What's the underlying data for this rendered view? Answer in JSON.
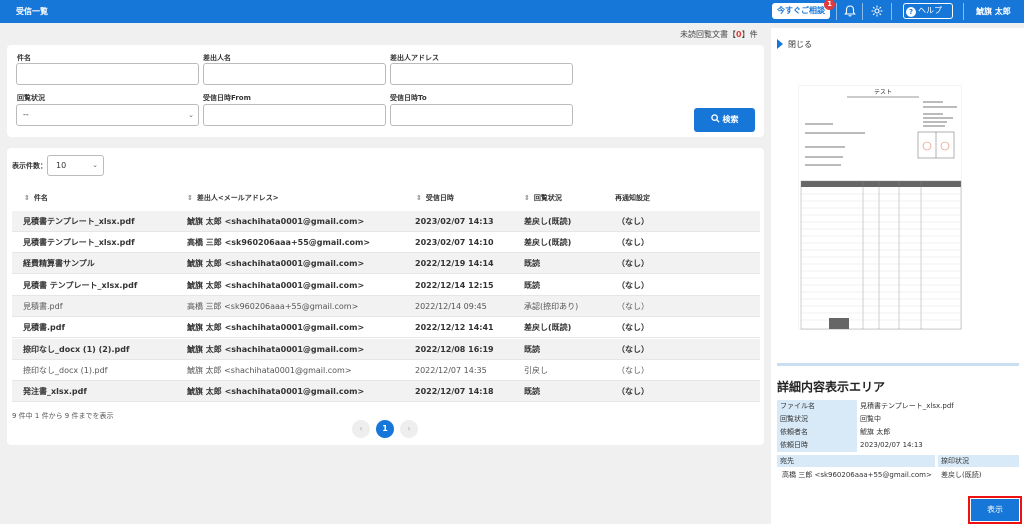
{
  "header": {
    "title": "受信一覧",
    "consult_label": "今すぐご相談",
    "consult_badge": "1",
    "help_label": "ヘルプ",
    "user": "鯱旗 太郎"
  },
  "unread": {
    "prefix": "未読回覧文書【",
    "count": "0",
    "suffix": "】件"
  },
  "search": {
    "subject_label": "件名",
    "sender_name_label": "差出人名",
    "sender_address_label": "差出人アドレス",
    "status_label": "回覧状況",
    "status_value": "--",
    "from_label": "受信日時From",
    "to_label": "受信日時To",
    "search_button": "検索"
  },
  "list": {
    "display_count_label": "表示件数：",
    "display_count_value": "10",
    "columns": [
      "件名",
      "差出人<メールアドレス>",
      "受信日時",
      "回覧状況",
      "再通知設定"
    ],
    "rows": [
      {
        "subject": "見積書テンプレート_xlsx.pdf",
        "sender": "鯱旗 太郎 <shachihata0001@gmail.com>",
        "date": "2023/02/07 14:13",
        "status": "差戻し(既読)",
        "renotify": "（なし）"
      },
      {
        "subject": "見積書テンプレート_xlsx.pdf",
        "sender": "高橋 三郎 <sk960206aaa+55@gmail.com>",
        "date": "2023/02/07 14:10",
        "status": "差戻し(既読)",
        "renotify": "（なし）"
      },
      {
        "subject": "経費精算書サンプル",
        "sender": "鯱旗 太郎 <shachihata0001@gmail.com>",
        "date": "2022/12/19 14:14",
        "status": "既読",
        "renotify": "（なし）"
      },
      {
        "subject": "見積書 テンプレート_xlsx.pdf",
        "sender": "鯱旗 太郎 <shachihata0001@gmail.com>",
        "date": "2022/12/14 12:15",
        "status": "既読",
        "renotify": "（なし）"
      },
      {
        "subject": "見積書.pdf",
        "sender": "高橋 三郎 <sk960206aaa+55@gmail.com>",
        "date": "2022/12/14 09:45",
        "status": "承認(捺印あり)",
        "renotify": "（なし）"
      },
      {
        "subject": "見積書.pdf",
        "sender": "鯱旗 太郎 <shachihata0001@gmail.com>",
        "date": "2022/12/12 14:41",
        "status": "差戻し(既読)",
        "renotify": "（なし）"
      },
      {
        "subject": "捺印なし_docx (1) (2).pdf",
        "sender": "鯱旗 太郎 <shachihata0001@gmail.com>",
        "date": "2022/12/08 16:19",
        "status": "既読",
        "renotify": "（なし）"
      },
      {
        "subject": "捺印なし_docx (1).pdf",
        "sender": "鯱旗 太郎 <shachihata0001@gmail.com>",
        "date": "2022/12/07 14:35",
        "status": "引戻し",
        "renotify": "（なし）"
      },
      {
        "subject": "発注書_xlsx.pdf",
        "sender": "鯱旗 太郎 <shachihata0001@gmail.com>",
        "date": "2022/12/07 14:18",
        "status": "既読",
        "renotify": "（なし）"
      }
    ],
    "footer_count": "9 件中 1 件から 9 件までを表示",
    "pager_prev": "‹",
    "pager_current": "1",
    "pager_next": "›"
  },
  "preview": {
    "close_label": "閉じる",
    "doc_title": "テスト"
  },
  "detail": {
    "title": "詳細内容表示エリア",
    "file_label": "ファイル名",
    "file_value": "見積書テンプレート_xlsx.pdf",
    "status_label": "回覧状況",
    "status_value": "回覧中",
    "requester_label": "依頼者名",
    "requester_value": "鯱旗 太郎",
    "date_label": "依頼日時",
    "date_value": "2023/02/07 14:13",
    "dest_label": "宛先",
    "stamp_label": "捺印状況",
    "dest_value": "高橋 三郎 <sk960206aaa+55@gmail.com>",
    "stamp_value": "差戻し(既読)",
    "show_button": "表示"
  },
  "colors": {
    "brand": "#1677d9",
    "accent_red": "#e23b3b",
    "detail_label_bg": "#d8e9f7"
  }
}
